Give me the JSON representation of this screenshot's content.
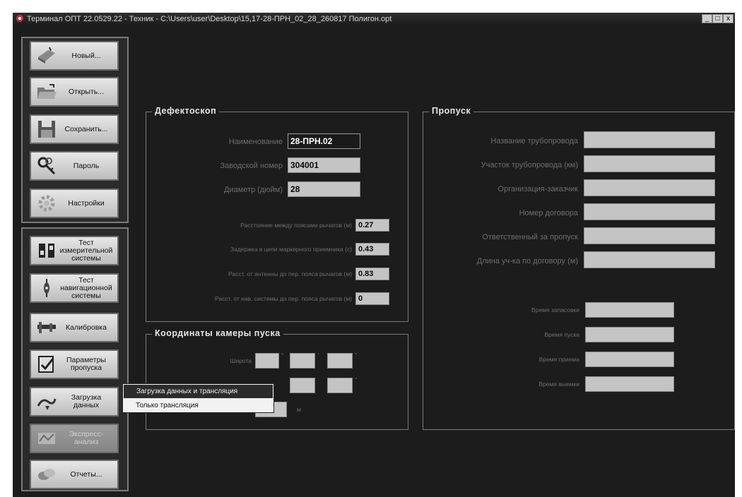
{
  "window": {
    "title": "Терминал ОПТ 22.0529.22 - Техник - C:\\Users\\user\\Desktop\\15,17-28-ПРН_02_28_260817 Полигон.opt",
    "controls": [
      "_",
      "□",
      "x"
    ]
  },
  "toolbar_top": {
    "items": [
      {
        "label": "Новый...",
        "icon": "new-file-icon"
      },
      {
        "label": "Открыть...",
        "icon": "open-folder-icon"
      },
      {
        "label": "Сохранить...",
        "icon": "save-disk-icon"
      },
      {
        "label": "Пароль",
        "icon": "keys-icon"
      },
      {
        "label": "Настройки",
        "icon": "settings-gear-icon"
      }
    ]
  },
  "toolbar_bottom": {
    "items": [
      {
        "label": "Тест измерительной системы",
        "icon": "measure-test-icon"
      },
      {
        "label": "Тест навигационной системы",
        "icon": "nav-test-icon"
      },
      {
        "label": "Калибровка",
        "icon": "caliper-icon"
      },
      {
        "label": "Параметры пропуска",
        "icon": "params-icon"
      },
      {
        "label": "Загрузка данных",
        "icon": "download-data-icon"
      },
      {
        "label": "Экспресс-анализ",
        "icon": "express-analysis-icon"
      },
      {
        "label": "Отчеты...",
        "icon": "reports-icon"
      }
    ]
  },
  "defectoscope": {
    "legend": "Дефектоскоп",
    "name_label": "Наименование",
    "name_value": "28-ПРН.02",
    "serial_label": "Заводской номер",
    "serial_value": "304001",
    "diameter_label": "Диаметр (дюйм)",
    "diameter_value": "28",
    "lever_dist_label": "Расстояние между поясами рычагов (м)",
    "lever_dist_value": "0.27",
    "marker_delay_label": "Задержка в цепи маркерного приемника (с)",
    "marker_delay_value": "0.43",
    "antenna_dist_label": "Расст. от антенны до пер. пояса рычагов (м)",
    "antenna_dist_value": "0.83",
    "nav_dist_label": "Расст. от нав. системы до пер. пояса рычагов (м)",
    "nav_dist_value": "0"
  },
  "launch_coords": {
    "legend": "Координаты камеры пуска",
    "latitude_label": "Широта",
    "deg_mark": "°",
    "min_mark": "'",
    "sec_mark": "\"",
    "height_unit": "м"
  },
  "pass": {
    "legend": "Пропуск",
    "pipeline_name_label": "Название трубопровода",
    "pipeline_section_label": "Участок трубопровода (км)",
    "customer_label": "Организация-заказчик",
    "contract_label": "Номер договора",
    "responsible_label": "Ответственный за пропуск",
    "length_label": "Длина уч-ка по договору (м)",
    "loading_time_label": "Время запасовки",
    "launch_time_label": "Время пуска",
    "receive_time_label": "Время приема",
    "extract_time_label": "Время выемки"
  },
  "context_menu": {
    "items": [
      "Загрузка данных и трансляция",
      "Только трансляция"
    ]
  }
}
